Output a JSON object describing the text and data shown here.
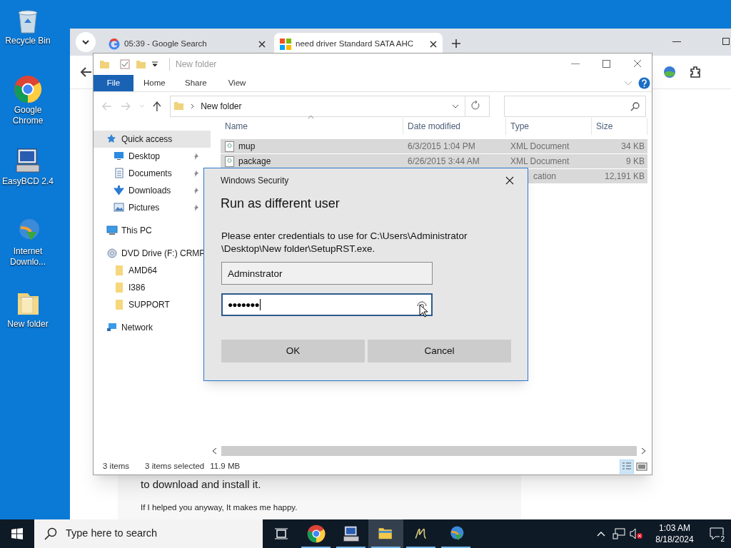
{
  "desktop_icons": [
    {
      "kind": "recycle",
      "label": "Recycle Bin"
    },
    {
      "kind": "chrome",
      "label": "Google Chrome"
    },
    {
      "kind": "easybcd",
      "label": "EasyBCD 2.4"
    },
    {
      "kind": "idm",
      "label": "Internet Downlo..."
    },
    {
      "kind": "folder",
      "label": "New folder"
    }
  ],
  "browser": {
    "tabs": [
      {
        "kind": "google",
        "title": "05:39 - Google Search",
        "selected": false
      },
      {
        "kind": "microsoft",
        "title": "need driver Standard SATA AHC",
        "selected": true
      }
    ],
    "page_text": [
      "to download and install it.",
      "If I helped you anyway, It makes me happy."
    ]
  },
  "explorer": {
    "title": "New folder",
    "ribbon_tabs": [
      {
        "label": "File",
        "selected": true
      },
      {
        "label": "Home",
        "selected": false
      },
      {
        "label": "Share",
        "selected": false
      },
      {
        "label": "View",
        "selected": false
      }
    ],
    "address": "New folder",
    "nav": [
      {
        "kind": "star",
        "label": "Quick access",
        "selected": true,
        "children": [
          {
            "kind": "desktop",
            "label": "Desktop",
            "pinned": true
          },
          {
            "kind": "doc",
            "label": "Documents",
            "pinned": true
          },
          {
            "kind": "download",
            "label": "Downloads",
            "pinned": true
          },
          {
            "kind": "pictures",
            "label": "Pictures",
            "pinned": true
          }
        ]
      },
      {
        "kind": "pc",
        "label": "This PC",
        "selected": false
      },
      {
        "kind": "dvd",
        "label": "DVD Drive (F:) CRMP",
        "selected": false,
        "children": [
          {
            "kind": "folder",
            "label": "AMD64"
          },
          {
            "kind": "folder",
            "label": "I386"
          },
          {
            "kind": "folder",
            "label": "SUPPORT"
          }
        ]
      },
      {
        "kind": "network",
        "label": "Network",
        "selected": false
      }
    ],
    "columns": [
      "Name",
      "Date modified",
      "Type",
      "Size"
    ],
    "rows": [
      {
        "name": "mup",
        "date": "6/3/2015 1:04 PM",
        "type": "XML Document",
        "size": "34 KB",
        "selected": true
      },
      {
        "name": "package",
        "date": "6/26/2015 3:44 AM",
        "type": "XML Document",
        "size": "9 KB",
        "selected": true
      },
      {
        "type": "cation",
        "size": "12,191 KB",
        "selected": true
      }
    ],
    "status": [
      "3 items",
      "3 items selected",
      "11.9 MB"
    ]
  },
  "dialog": {
    "title": "Windows Security",
    "heading": "Run as different user",
    "message": "Please enter credentials to use for C:\\Users\\Administrator \\Desktop\\New folder\\SetupRST.exe.",
    "username": "Adminstrator",
    "password": "●●●●●●●",
    "buttons": [
      "OK",
      "Cancel"
    ]
  },
  "taskbar": {
    "search_placeholder": "Type here to search",
    "apps": [
      {
        "kind": "taskview",
        "running": false,
        "selected": false
      },
      {
        "kind": "chrome",
        "running": true,
        "selected": false
      },
      {
        "kind": "easybcd",
        "running": true,
        "selected": false
      },
      {
        "kind": "explorer",
        "running": true,
        "selected": true
      },
      {
        "kind": "n",
        "running": true,
        "selected": false
      },
      {
        "kind": "idm",
        "running": true,
        "selected": false
      }
    ],
    "time": "1:03 AM",
    "date": "8/18/2024",
    "notifications": "2"
  }
}
